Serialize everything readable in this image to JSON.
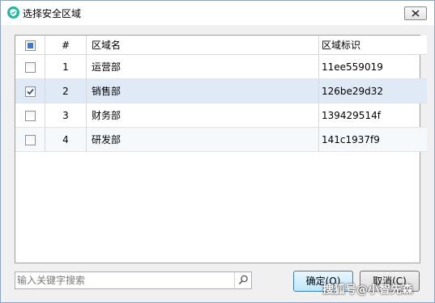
{
  "window": {
    "title": "选择安全区域",
    "icon": "shield-app-icon",
    "close_icon": "close-icon"
  },
  "table": {
    "columns": {
      "number": "#",
      "name": "区域名",
      "id": "区域标识"
    },
    "rows": [
      {
        "number": "1",
        "name": "运营部",
        "id": "11ee559019",
        "checked": false
      },
      {
        "number": "2",
        "name": "销售部",
        "id": "126be29d32",
        "checked": true
      },
      {
        "number": "3",
        "name": "财务部",
        "id": "139429514f",
        "checked": false
      },
      {
        "number": "4",
        "name": "研发部",
        "id": "141c1937f9",
        "checked": false
      }
    ]
  },
  "search": {
    "placeholder": "输入关键字搜索",
    "value": "",
    "icon": "search-icon"
  },
  "buttons": {
    "ok": "确定(O)",
    "cancel": "取消(C)"
  },
  "watermark": "搜狐号@小智先森",
  "colors": {
    "selected_row": "#dfeaf6",
    "accent": "#1fb8a4",
    "checkbox_fill": "#3d7bc8"
  }
}
